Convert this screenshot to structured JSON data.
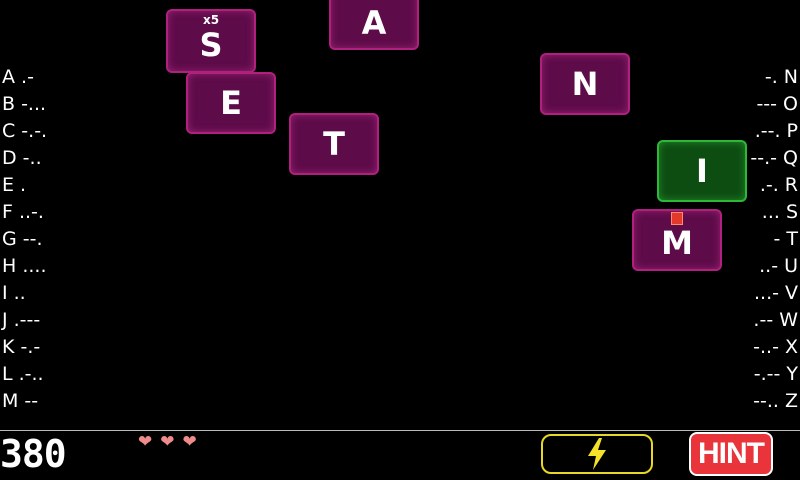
{
  "morse_left": [
    {
      "text": "A .-"
    },
    {
      "text": "B -..."
    },
    {
      "text": "C -.-."
    },
    {
      "text": "D -.."
    },
    {
      "text": "E ."
    },
    {
      "text": "F ..-."
    },
    {
      "text": "G --."
    },
    {
      "text": "H ...."
    },
    {
      "text": "I .."
    },
    {
      "text": "J .---"
    },
    {
      "text": "K -.-"
    },
    {
      "text": "L .-.."
    },
    {
      "text": "M --"
    }
  ],
  "morse_right": [
    {
      "text": "-. N"
    },
    {
      "text": "--- O"
    },
    {
      "text": ".--. P"
    },
    {
      "text": "--.- Q"
    },
    {
      "text": ".-. R"
    },
    {
      "text": "... S"
    },
    {
      "text": "- T"
    },
    {
      "text": "..- U"
    },
    {
      "text": "...- V"
    },
    {
      "text": ".-- W"
    },
    {
      "text": "-..- X"
    },
    {
      "text": "-.-- Y"
    },
    {
      "text": "--.. Z"
    }
  ],
  "tiles": {
    "s": {
      "letter": "S",
      "multiplier": "x5"
    },
    "a": {
      "letter": "A"
    },
    "e": {
      "letter": "E"
    },
    "t": {
      "letter": "T"
    },
    "n": {
      "letter": "N"
    },
    "i": {
      "letter": "I",
      "state": "selected"
    },
    "m": {
      "letter": "M"
    }
  },
  "hud": {
    "score": "380",
    "lives": 3,
    "hint_label": "HINT",
    "power_icon": "lightning-bolt-icon",
    "colors": {
      "power_border": "#e7d728",
      "hint_bg": "#e8343a",
      "tile_bg": "#5e0b4a",
      "tile_selected_bg": "#0d4d12",
      "heart": "#f08b8b"
    }
  }
}
